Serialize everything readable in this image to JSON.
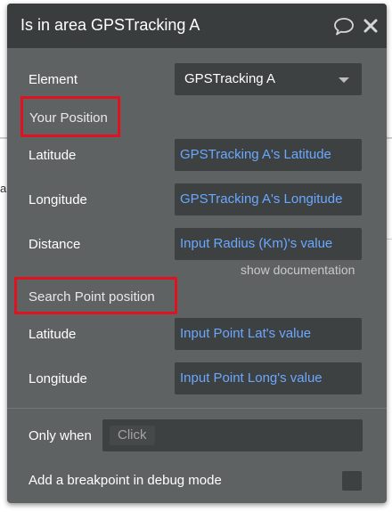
{
  "window": {
    "title": "Is in area GPSTracking A"
  },
  "icons": {
    "comment": "comment-bubble-icon",
    "close": "close-icon",
    "dropdown": "chevron-down-icon"
  },
  "element_row": {
    "label": "Element",
    "value": "GPSTracking A"
  },
  "your_position": {
    "header": "Your Position",
    "latitude_label": "Latitude",
    "latitude_value": "GPSTracking A's Latitude",
    "longitude_label": "Longitude",
    "longitude_value": "GPSTracking A's Longitude",
    "distance_label": "Distance",
    "distance_value": "Input Radius (Km)'s value"
  },
  "show_documentation": "show documentation",
  "search_point": {
    "header": "Search Point position",
    "latitude_label": "Latitude",
    "latitude_value": "Input Point Lat's value",
    "longitude_label": "Longitude",
    "longitude_value": "Input Point Long's value"
  },
  "only_when": {
    "label": "Only when",
    "placeholder": "Click"
  },
  "breakpoint": {
    "label": "Add a breakpoint in debug mode",
    "checked": false
  },
  "colors": {
    "panel_bg": "#5f6263",
    "titlebar_bg": "#3a3d3e",
    "field_bg": "#3e4142",
    "dynamic_text": "#6aa8ff",
    "highlight": "#e0121f"
  }
}
